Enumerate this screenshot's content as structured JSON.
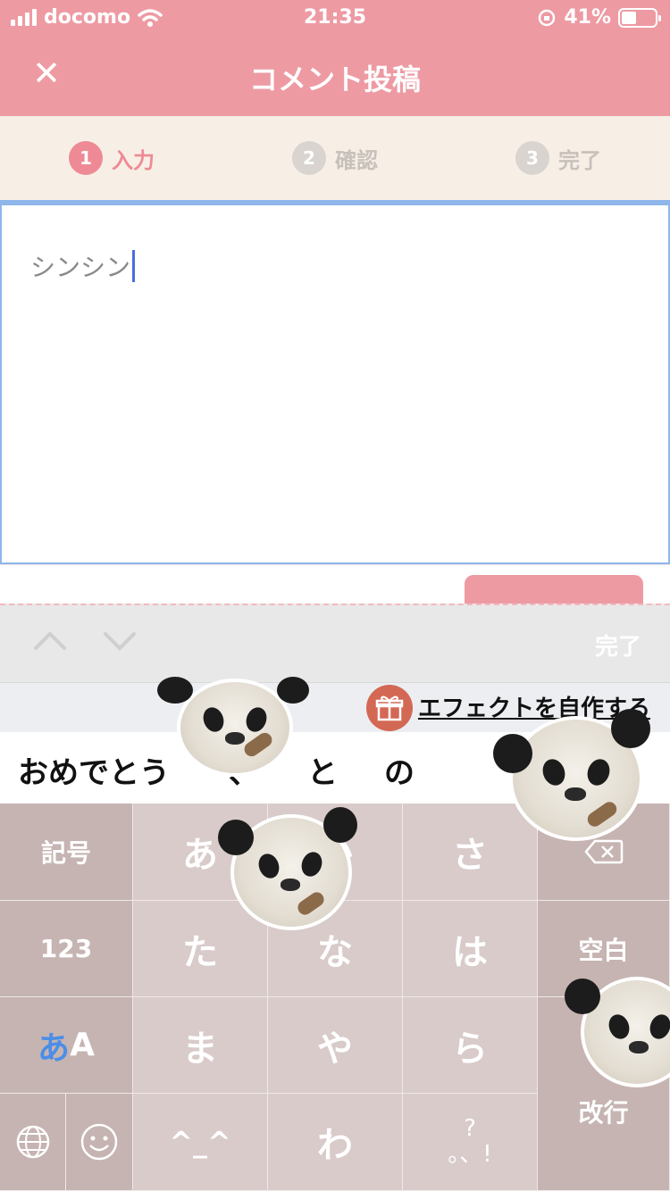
{
  "status_bar": {
    "carrier": "docomo",
    "time": "21:35",
    "battery": "41%",
    "battery_level": 0.41
  },
  "header": {
    "title": "コメント投稿",
    "close_icon": "close-icon"
  },
  "steps": [
    {
      "number": "1",
      "label": "入力",
      "active": true
    },
    {
      "number": "2",
      "label": "確認",
      "active": false
    },
    {
      "number": "3",
      "label": "完了",
      "active": false
    }
  ],
  "comment": {
    "value": "シンシン"
  },
  "accessory": {
    "done_label": "完了"
  },
  "effect": {
    "link_label": "エフェクトを自作する",
    "icon": "gift-icon"
  },
  "candidates": [
    "おめでとう",
    "、",
    "と",
    "の"
  ],
  "keyboard": {
    "symbols": "記号",
    "numbers": "123",
    "kana_a": "あ",
    "kana_ka": "か",
    "kana_sa": "さ",
    "kana_ta": "た",
    "kana_na": "な",
    "kana_ha": "は",
    "kana_ma": "ま",
    "kana_ya": "や",
    "kana_ra": "ら",
    "kana_wa": "わ",
    "face": "^_^",
    "punct_top": "?",
    "punct_bottom": "。、!",
    "space": "空白",
    "enter": "改行",
    "mode_a": "あ",
    "mode_b": "A"
  },
  "colors": {
    "header": "#ee9aa3",
    "accent": "#ee8a95",
    "focus_border": "#8fb6ea",
    "gift": "#d36855"
  }
}
